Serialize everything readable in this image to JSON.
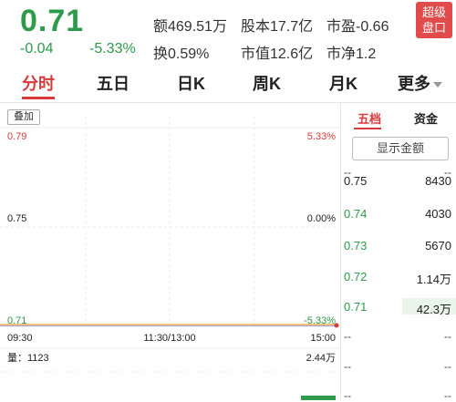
{
  "header": {
    "price": "0.71",
    "change": "-0.04",
    "change_pct": "-5.33%",
    "amount": "额469.51万",
    "turnover": "换0.59%",
    "share_capital": "股本17.7亿",
    "market_cap": "市值12.6亿",
    "pe": "市盈-0.66",
    "pb": "市净1.2",
    "badge_line1": "超级",
    "badge_line2": "盘口"
  },
  "tabs": [
    "分时",
    "五日",
    "日K",
    "周K",
    "月K",
    "更多"
  ],
  "chart": {
    "overlay_label": "叠加",
    "price_high": "0.79",
    "price_mid": "0.75",
    "price_low": "0.71",
    "pct_high": "5.33%",
    "pct_mid": "0.00%",
    "pct_low": "-5.33%",
    "time_start": "09:30",
    "time_mid": "11:30/13:00",
    "time_end": "15:00",
    "volume_label": "量：1123",
    "volume_max": "2.44万",
    "colors": {
      "up": "#d83a3a",
      "down": "#2e9a4a",
      "line": "#e0a020"
    }
  },
  "order_book": {
    "tab_five": "五档",
    "tab_funds": "资金",
    "show_amount": "显示金额",
    "levels": [
      {
        "price": "0.75",
        "volume": "8430",
        "level": 0.0
      },
      {
        "price": "0.74",
        "volume": "4030",
        "level": 0.0
      },
      {
        "price": "0.73",
        "volume": "5670",
        "level": 0.0
      },
      {
        "price": "0.72",
        "volume": "1.14万",
        "level": 0.0
      },
      {
        "price": "0.71",
        "volume": "42.3万",
        "level": 1.0
      }
    ],
    "empty": "--"
  }
}
